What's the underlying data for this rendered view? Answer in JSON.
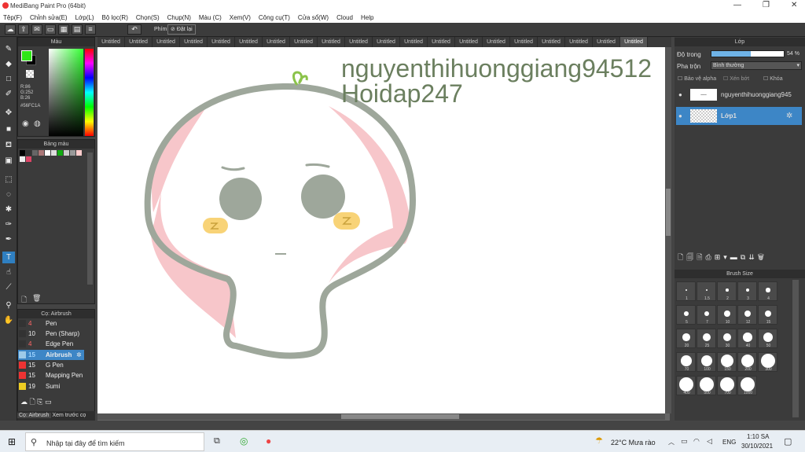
{
  "window": {
    "title": "MediBang Paint Pro (64bit)",
    "min": "—",
    "max": "❐",
    "close": "✕"
  },
  "menu": [
    "Tệp(F)",
    "Chỉnh sửa(E)",
    "Lớp(L)",
    "Bộ lọc(R)",
    "Chọn(S)",
    "Chụp(N)",
    "Màu (C)",
    "Xem(V)",
    "Công cụ(T)",
    "Cửa sổ(W)",
    "Cloud",
    "Help"
  ],
  "toolbar": {
    "phim": "Phím",
    "reset": "Đặt lại"
  },
  "color_panel": {
    "title": "Màu",
    "r": "R:86",
    "g": "G:252",
    "b": "B:26",
    "hex": "#56FC1A",
    "primary": "#2ee616",
    "secondary": "#000000"
  },
  "palette": {
    "title": "Bảng màu",
    "colors": [
      "#000000",
      "#333333",
      "#666666",
      "#aa7777",
      "#ffffff",
      "#dddddd",
      "#11aa11",
      "#cccccc",
      "#999999",
      "#ffcccc",
      "#eeeeee",
      "#dd4466"
    ]
  },
  "brush_panel": {
    "title": "Cọ: Airbrush",
    "items": [
      {
        "size": "4",
        "name": "Pen",
        "color": "#333333"
      },
      {
        "size": "10",
        "name": "Pen (Sharp)",
        "color": "#333333"
      },
      {
        "size": "4",
        "name": "Edge Pen",
        "color": "#333333"
      },
      {
        "size": "15",
        "name": "Airbrush",
        "color": "#9ecae8",
        "active": true
      },
      {
        "size": "15",
        "name": "G Pen",
        "color": "#ee3333"
      },
      {
        "size": "15",
        "name": "Mapping Pen",
        "color": "#ee3333"
      },
      {
        "size": "19",
        "name": "Sumi",
        "color": "#eecc22"
      }
    ],
    "tab1": "Cọ: Airbrush",
    "tab2": "Xem trước cọ"
  },
  "tabs": [
    "Untitled",
    "Untitled",
    "Untitled",
    "Untitled",
    "Untitled",
    "Untitled",
    "Untitled",
    "Untitled",
    "Untitled",
    "Untitled",
    "Untitled",
    "Untitled",
    "Untitled",
    "Untitled",
    "Untitled",
    "Untitled",
    "Untitled",
    "Untitled",
    "Untitled",
    "Untitled"
  ],
  "canvas_text": {
    "line1": "nguyenthihuonggiang94512",
    "line2": "Hoidap247"
  },
  "layer_panel": {
    "title": "Lớp",
    "opacity_label": "Độ trong",
    "opacity_value": "54 %",
    "opacity": 0.54,
    "blend_label": "Pha trộn",
    "blend_value": "Bình thường",
    "protect_alpha": "Bảo vệ alpha",
    "clipping": "Xén bớt",
    "lock": "Khóa",
    "layers": [
      {
        "name": "nguyenthihuonggiang945"
      },
      {
        "name": "Lớp1",
        "active": true
      }
    ]
  },
  "brush_size": {
    "title": "Brush Size",
    "sizes": [
      "1",
      "1.5",
      "2",
      "3",
      "4",
      "5",
      "7",
      "10",
      "12",
      "15",
      "20",
      "25",
      "30",
      "40",
      "50",
      "70",
      "100",
      "150",
      "200",
      "300",
      "400",
      "500",
      "700",
      "1000"
    ]
  },
  "taskbar": {
    "search": "Nhập tại đây để tìm kiếm",
    "weather": "22°C  Mưa rào",
    "lang": "ENG",
    "time": "1:10 SA",
    "date": "30/10/2021"
  }
}
